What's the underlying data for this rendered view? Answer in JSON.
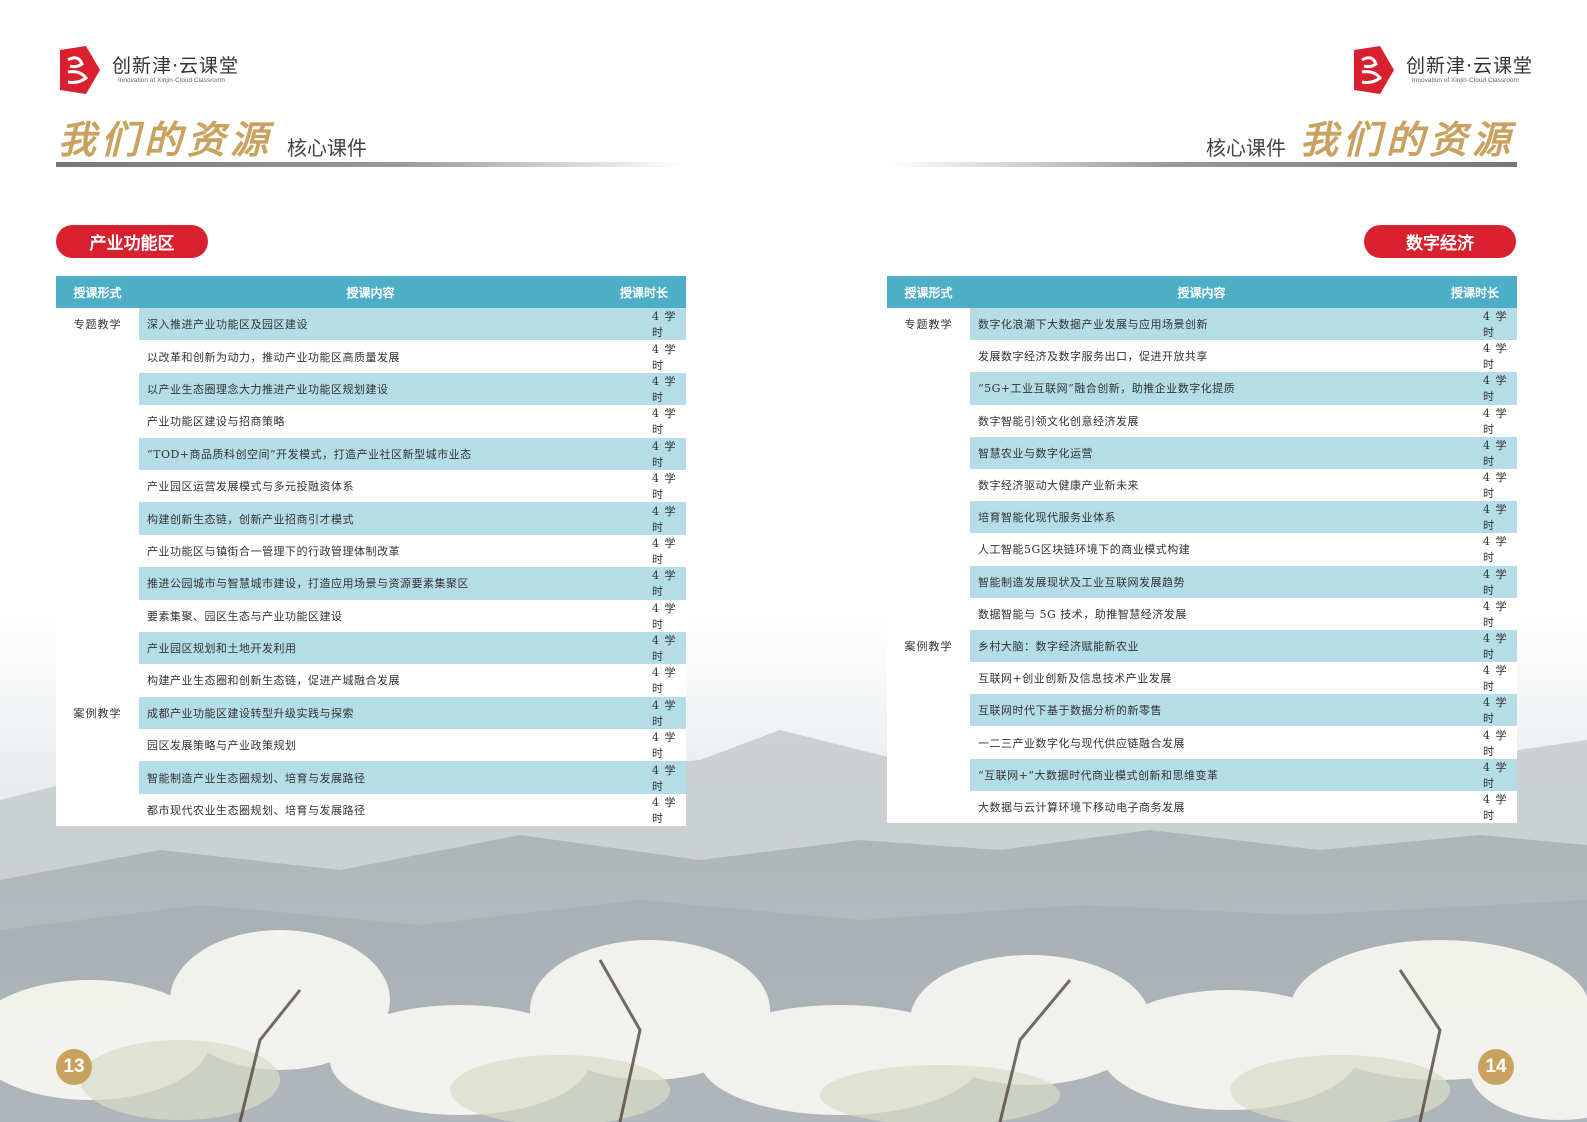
{
  "colors": {
    "accent_red": "#d8202f",
    "header_teal": "#4eaec8",
    "row_blue": "#b5dde8",
    "title_gold": "#c9a25f"
  },
  "logo": {
    "cn": "创新津·云课堂",
    "en": "Innovation of Xinjin·Cloud Classroom",
    "icon": "brand-mark-icon"
  },
  "left_page": {
    "title": "我们的资源",
    "subtitle": "核心课件",
    "section": "产业功能区",
    "headers": [
      "授课形式",
      "授课内容",
      "授课时长"
    ],
    "rows": [
      {
        "form": "专题教学",
        "content": "深入推进产业功能区及园区建设",
        "hours": "4 学时"
      },
      {
        "form": "",
        "content": "以改革和创新为动力，推动产业功能区高质量发展",
        "hours": "4 学时"
      },
      {
        "form": "",
        "content": "以产业生态圈理念大力推进产业功能区规划建设",
        "hours": "4 学时"
      },
      {
        "form": "",
        "content": "产业功能区建设与招商策略",
        "hours": "4 学时"
      },
      {
        "form": "",
        "content": "“TOD+商品质科创空间”开发模式，打造产业社区新型城市业态",
        "hours": "4 学时"
      },
      {
        "form": "",
        "content": "产业园区运营发展模式与多元投融资体系",
        "hours": "4 学时"
      },
      {
        "form": "",
        "content": "构建创新生态链，创新产业招商引才模式",
        "hours": "4 学时"
      },
      {
        "form": "",
        "content": "产业功能区与镇街合一管理下的行政管理体制改革",
        "hours": "4 学时"
      },
      {
        "form": "",
        "content": "推进公园城市与智慧城市建设，打造应用场景与资源要素集聚区",
        "hours": "4 学时"
      },
      {
        "form": "",
        "content": "要素集聚、园区生态与产业功能区建设",
        "hours": "4 学时"
      },
      {
        "form": "",
        "content": "产业园区规划和土地开发利用",
        "hours": "4 学时"
      },
      {
        "form": "",
        "content": "构建产业生态圈和创新生态链，促进产城融合发展",
        "hours": "4 学时"
      },
      {
        "form": "案例教学",
        "content": "成都产业功能区建设转型升级实践与探索",
        "hours": "4 学时"
      },
      {
        "form": "",
        "content": "园区发展策略与产业政策规划",
        "hours": "4 学时"
      },
      {
        "form": "",
        "content": "智能制造产业生态圈规划、培育与发展路径",
        "hours": "4 学时"
      },
      {
        "form": "",
        "content": "都市现代农业生态圈规划、培育与发展路径",
        "hours": "4 学时"
      }
    ],
    "page_number": "13"
  },
  "right_page": {
    "title": "我们的资源",
    "subtitle": "核心课件",
    "section": "数字经济",
    "headers": [
      "授课形式",
      "授课内容",
      "授课时长"
    ],
    "rows": [
      {
        "form": "专题教学",
        "content": "数字化浪潮下大数据产业发展与应用场景创新",
        "hours": "4 学时"
      },
      {
        "form": "",
        "content": "发展数字经济及数字服务出口，促进开放共享",
        "hours": "4 学时"
      },
      {
        "form": "",
        "content": "“5G+工业互联网”融合创新，助推企业数字化提质",
        "hours": "4 学时"
      },
      {
        "form": "",
        "content": "数字智能引领文化创意经济发展",
        "hours": "4 学时"
      },
      {
        "form": "",
        "content": "智慧农业与数字化运营",
        "hours": "4 学时"
      },
      {
        "form": "",
        "content": "数字经济驱动大健康产业新未来",
        "hours": "4 学时"
      },
      {
        "form": "",
        "content": "培育智能化现代服务业体系",
        "hours": "4 学时"
      },
      {
        "form": "",
        "content": "人工智能5G区块链环境下的商业模式构建",
        "hours": "4 学时"
      },
      {
        "form": "",
        "content": "智能制造发展现状及工业互联网发展趋势",
        "hours": "4 学时"
      },
      {
        "form": "",
        "content": "数据智能与 5G 技术，助推智慧经济发展",
        "hours": "4 学时"
      },
      {
        "form": "案例教学",
        "content": "乡村大脑：数字经济赋能新农业",
        "hours": "4 学时"
      },
      {
        "form": "",
        "content": "互联网+创业创新及信息技术产业发展",
        "hours": "4 学时"
      },
      {
        "form": "",
        "content": "互联网时代下基于数据分析的新零售",
        "hours": "4 学时"
      },
      {
        "form": "",
        "content": "一二三产业数字化与现代供应链融合发展",
        "hours": "4 学时"
      },
      {
        "form": "",
        "content": "“互联网+”大数据时代商业模式创新和思维变革",
        "hours": "4 学时"
      },
      {
        "form": "",
        "content": "大数据与云计算环境下移动电子商务发展",
        "hours": "4 学时"
      }
    ],
    "page_number": "14"
  }
}
